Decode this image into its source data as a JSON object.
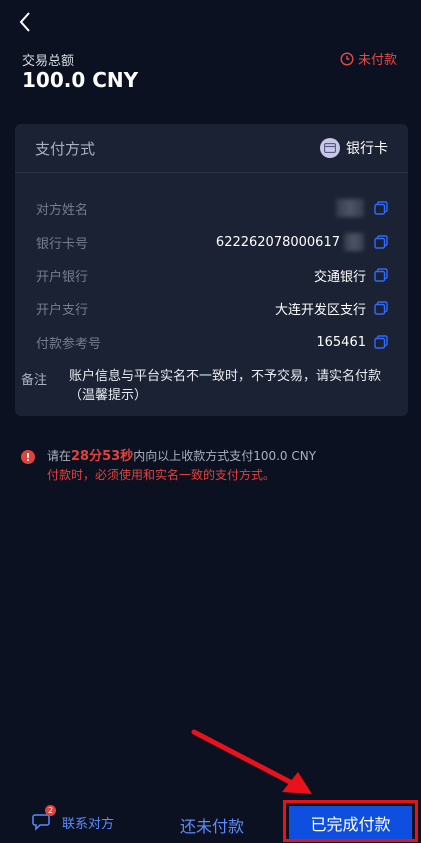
{
  "header": {
    "total_label": "交易总额",
    "total_amount": "100.0 CNY",
    "status": "未付款"
  },
  "card": {
    "title": "支付方式",
    "method": "银行卡",
    "rows": [
      {
        "label": "对方姓名",
        "value": ""
      },
      {
        "label": "银行卡号",
        "value": "622262078000617"
      },
      {
        "label": "开户银行",
        "value": "交通银行"
      },
      {
        "label": "开户支行",
        "value": "大连开发区支行"
      },
      {
        "label": "付款参考号",
        "value": "165461"
      }
    ],
    "note_label": "备注",
    "note_text": "账户信息与平台实名不一致时，不予交易，请实名付款（温馨提示）"
  },
  "warning": {
    "prefix": "请在",
    "time": "28分53秒",
    "suffix": "内向以上收款方式支付100.0 CNY",
    "line2": "付款时，必须使用和实名一致的支付方式。"
  },
  "bottom": {
    "contact_label": "联系对方",
    "contact_badge": "2",
    "unpaid_label": "还未付款",
    "done_label": "已完成付款"
  },
  "colors": {
    "background": "#0b1120",
    "card": "#1b2233",
    "accent_blue": "#0f4fe0",
    "link_blue": "#5a8cff",
    "alert_red": "#e0423c",
    "highlight_red": "#e8121b"
  }
}
